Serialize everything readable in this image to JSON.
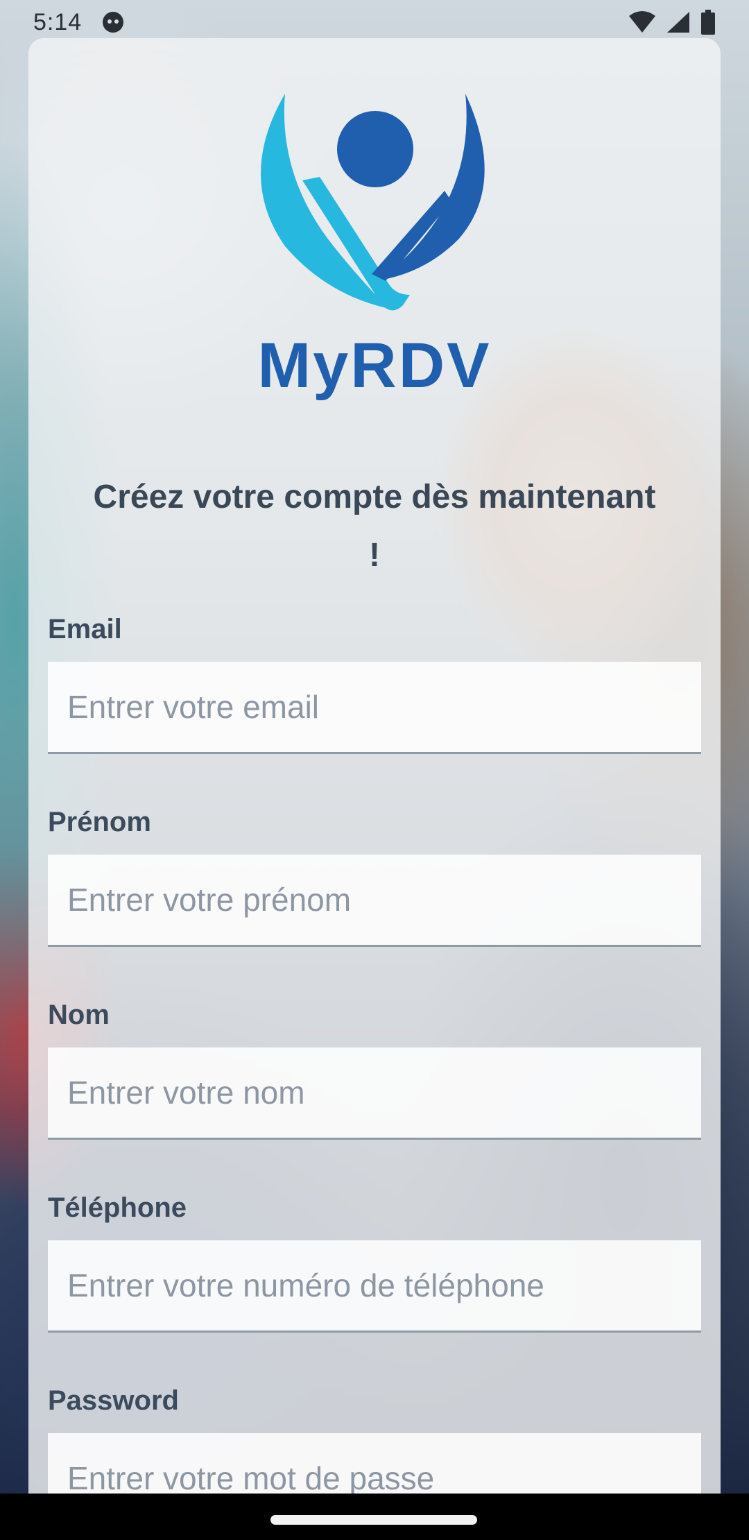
{
  "status_bar": {
    "time": "5:14",
    "icons": [
      "app-notification-icon",
      "wifi-icon",
      "signal-icon",
      "battery-icon"
    ]
  },
  "brand": {
    "name": "MyRDV",
    "colors": {
      "primary": "#1f5fae",
      "light": "#27b8e0"
    }
  },
  "headline": "Créez votre compte dès maintenant !",
  "form": {
    "email": {
      "label": "Email",
      "placeholder": "Entrer votre email"
    },
    "first_name": {
      "label": "Prénom",
      "placeholder": "Entrer votre prénom"
    },
    "last_name": {
      "label": "Nom",
      "placeholder": "Entrer votre nom"
    },
    "phone": {
      "label": "Téléphone",
      "placeholder": "Entrer votre numéro de téléphone"
    },
    "password": {
      "label": "Password",
      "placeholder": "Entrer votre mot de passe"
    }
  }
}
